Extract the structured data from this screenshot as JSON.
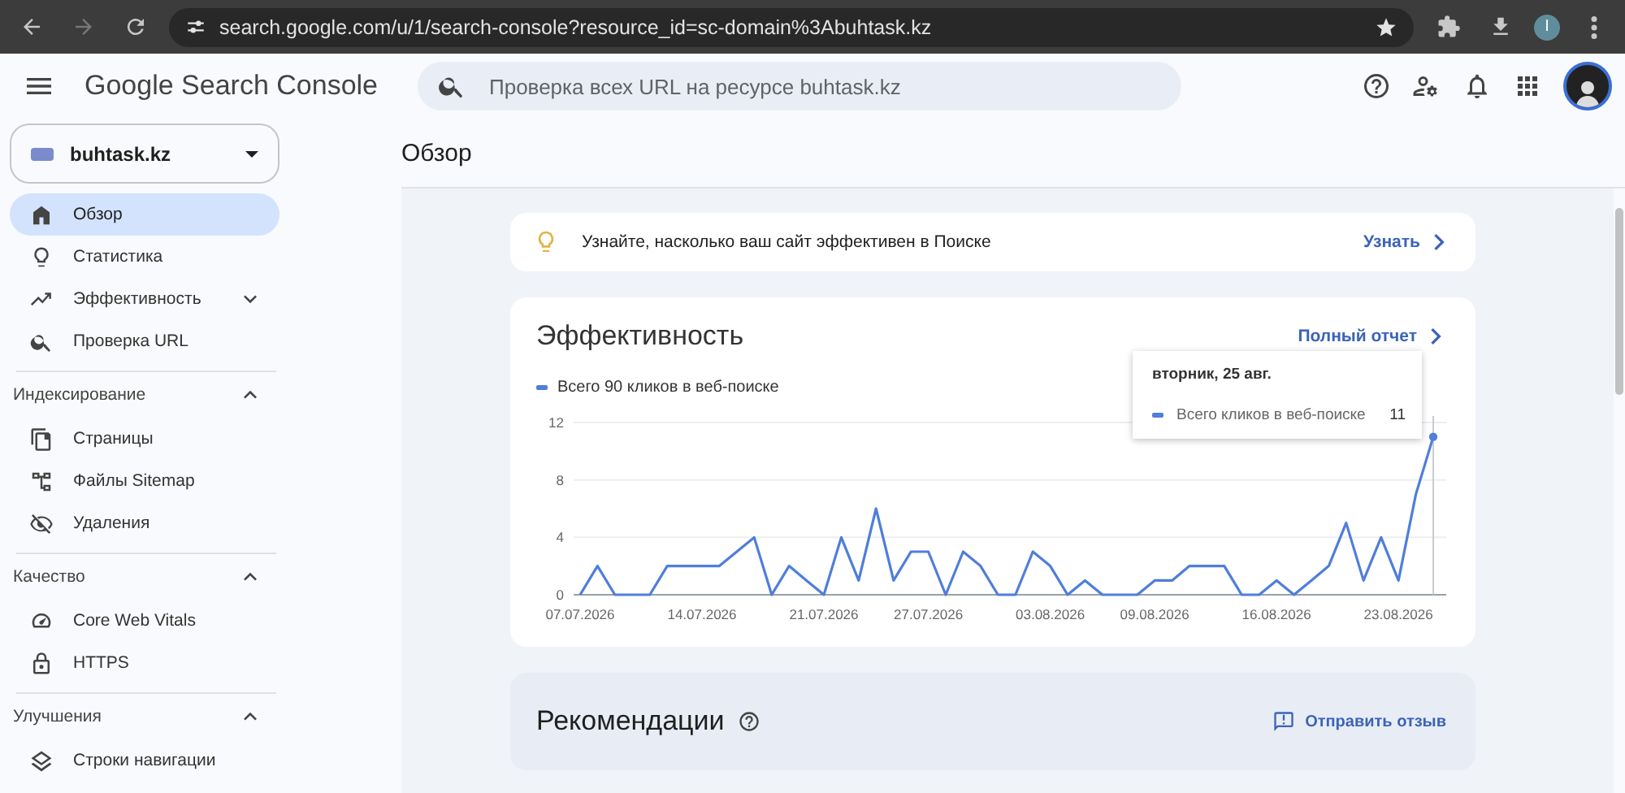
{
  "browser": {
    "url": "search.google.com/u/1/search-console?resource_id=sc-domain%3Abuhtask.kz",
    "profile_initial": "I"
  },
  "header": {
    "product": "Google Search Console",
    "search_placeholder": "Проверка всех URL на ресурсе buhtask.kz"
  },
  "property": {
    "name": "buhtask.kz"
  },
  "sidebar": {
    "items": [
      {
        "label": "Обзор",
        "selected": true
      },
      {
        "label": "Статистика",
        "selected": false
      },
      {
        "label": "Эффективность",
        "selected": false,
        "expanded": false
      },
      {
        "label": "Проверка URL",
        "selected": false
      }
    ],
    "sections": [
      {
        "title": "Индексирование",
        "expanded": true,
        "items": [
          {
            "label": "Страницы",
            "selected": false
          },
          {
            "label": "Файлы Sitemap",
            "selected": false
          },
          {
            "label": "Удаления",
            "selected": false
          }
        ]
      },
      {
        "title": "Качество",
        "expanded": true,
        "items": [
          {
            "label": "Core Web Vitals",
            "selected": false
          },
          {
            "label": "HTTPS",
            "selected": false
          }
        ]
      },
      {
        "title": "Улучшения",
        "expanded": true,
        "items": [
          {
            "label": "Строки навигации",
            "selected": false
          }
        ]
      }
    ]
  },
  "page": {
    "title": "Обзор"
  },
  "insight": {
    "text": "Узнайте, насколько ваш сайт эффективен в Поиске",
    "link": "Узнать"
  },
  "performance": {
    "title": "Эффективность",
    "link": "Полный отчет",
    "tooltip": {
      "date": "вторник, 25 авг.",
      "label": "Всего кликов в веб-поиске",
      "value": "11"
    },
    "chart_data": {
      "type": "line",
      "categories": [
        "07.07.2026",
        null,
        null,
        null,
        null,
        null,
        null,
        "14.07.2026",
        null,
        null,
        null,
        null,
        null,
        null,
        "21.07.2026",
        null,
        null,
        null,
        null,
        null,
        "27.07.2026",
        null,
        null,
        null,
        null,
        null,
        null,
        "03.08.2026",
        null,
        null,
        null,
        null,
        null,
        "09.08.2026",
        null,
        null,
        null,
        null,
        null,
        null,
        "16.08.2026",
        null,
        null,
        null,
        null,
        null,
        null,
        "23.08.2026",
        null,
        null
      ],
      "series": [
        {
          "name": "Всего 90 кликов в веб-поиске",
          "color": "#4f7edb",
          "values": [
            0,
            2,
            0,
            0,
            0,
            2,
            2,
            2,
            2,
            3,
            4,
            0,
            2,
            1,
            0,
            4,
            1,
            6,
            1,
            3,
            3,
            0,
            3,
            2,
            0,
            0,
            3,
            2,
            0,
            1,
            0,
            0,
            0,
            1,
            1,
            2,
            2,
            2,
            0,
            0,
            1,
            0,
            1,
            2,
            5,
            1,
            4,
            1,
            7,
            11
          ]
        }
      ],
      "ylim": [
        0,
        12
      ],
      "yticks": [
        0,
        4,
        8,
        12
      ]
    }
  },
  "recommendations": {
    "title": "Рекомендации",
    "link": "Отправить отзыв"
  }
}
